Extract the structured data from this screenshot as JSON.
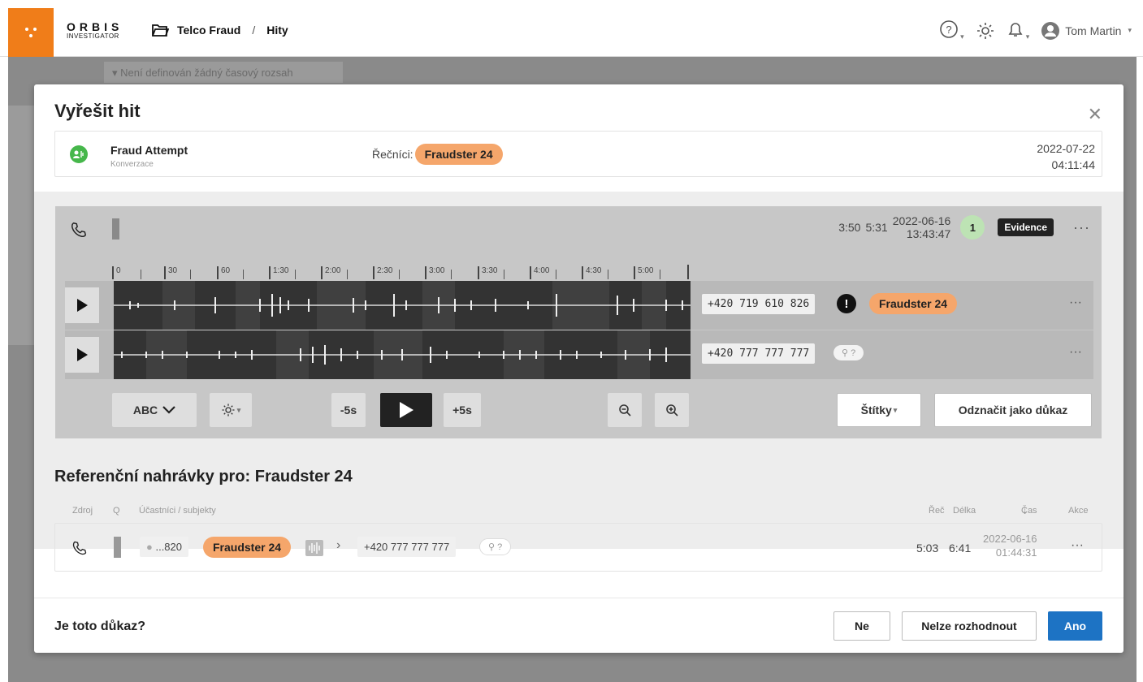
{
  "app": {
    "brand_top": "ORBIS",
    "brand_bottom": "INVESTIGATOR",
    "breadcrumb": [
      "Telco Fraud",
      "Hity"
    ],
    "breadcrumb_sep": "/",
    "user": "Tom Martin",
    "accent": "#f07d19"
  },
  "background": {
    "filter_text": "Není definován žádný časový rozsah"
  },
  "modal": {
    "title": "Vyřešit hit",
    "hit": {
      "name": "Fraud Attempt",
      "subtitle": "Konverzace",
      "speakers_label": "Řečníci:",
      "speaker": "Fraudster 24",
      "date": "2022-07-22",
      "time": "04:11:44"
    },
    "player": {
      "duration_a": "3:50",
      "duration_b": "5:31",
      "date": "2022-06-16",
      "time": "13:43:47",
      "count": "1",
      "evidence_label": "Evidence",
      "ticks": [
        "0",
        "30",
        "60",
        "1:30",
        "2:00",
        "2:30",
        "3:00",
        "3:30",
        "4:00",
        "4:30",
        "5:00"
      ],
      "tracks": [
        {
          "number": "+420 719 610 826",
          "speaker": "Fraudster 24",
          "alert": "!"
        },
        {
          "number": "+420 777 777 777",
          "unknown": "?"
        }
      ],
      "controls": {
        "abc": "ABC",
        "back": "-5s",
        "forward": "+5s",
        "tags": "Štítky",
        "mark": "Odznačit jako důkaz"
      }
    },
    "reference": {
      "title": "Referenční nahrávky pro: Fraudster 24",
      "headers": {
        "source": "Zdroj",
        "q": "Q",
        "participants": "Účastníci / subjekty",
        "speech": "Řeč",
        "length": "Délka",
        "time": "Čas",
        "action": "Akce"
      },
      "row": {
        "number_short": "...820",
        "speaker": "Fraudster 24",
        "other_number": "+420 777 777 777",
        "unknown": "?",
        "speech": "5:03",
        "length": "6:41",
        "date": "2022-06-16",
        "time": "01:44:31"
      }
    },
    "footer": {
      "question": "Je toto důkaz?",
      "no": "Ne",
      "undecided": "Nelze rozhodnout",
      "yes": "Ano"
    }
  }
}
